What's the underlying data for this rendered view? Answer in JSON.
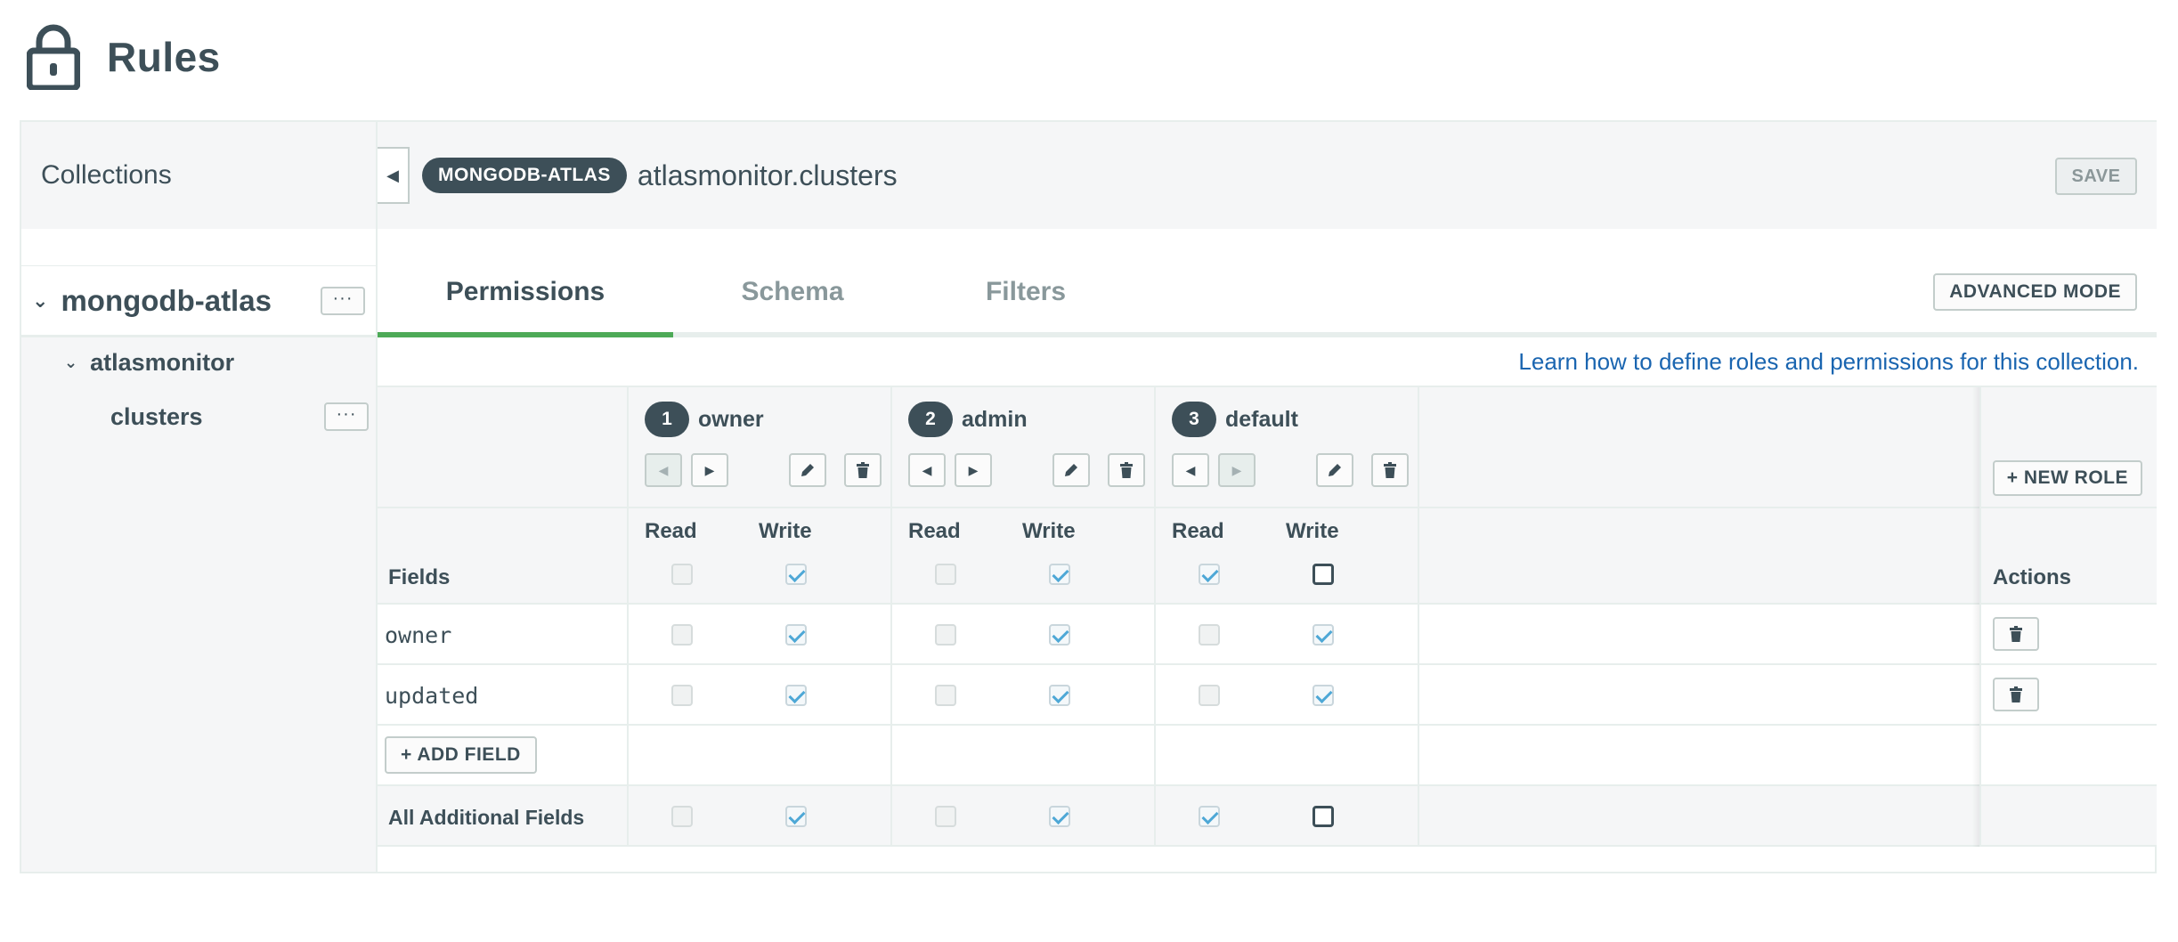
{
  "page": {
    "title": "Rules"
  },
  "sidebar": {
    "header": "Collections",
    "service": {
      "name": "mongodb-atlas",
      "menu_label": "···"
    },
    "database": {
      "name": "atlasmonitor"
    },
    "collection": {
      "name": "clusters",
      "menu_label": "···"
    }
  },
  "main": {
    "service_badge": "MONGODB-ATLAS",
    "collection_title": "atlasmonitor.clusters",
    "save_label": "SAVE",
    "tabs": [
      {
        "label": "Permissions",
        "active": true
      },
      {
        "label": "Schema",
        "active": false
      },
      {
        "label": "Filters",
        "active": false
      }
    ],
    "advanced_mode_label": "ADVANCED MODE",
    "learn_link": "Learn how to define roles and permissions for this collection."
  },
  "table": {
    "fields_header": "Fields",
    "actions_header": "Actions",
    "new_role_label": "+ NEW ROLE",
    "read_label": "Read",
    "write_label": "Write",
    "add_field_label": "+ ADD FIELD",
    "additional_fields_label": "All Additional Fields",
    "roles": [
      {
        "number": "1",
        "name": "owner"
      },
      {
        "number": "2",
        "name": "admin"
      },
      {
        "number": "3",
        "name": "default"
      }
    ],
    "fields": [
      {
        "name": "owner"
      },
      {
        "name": "updated"
      }
    ]
  }
}
